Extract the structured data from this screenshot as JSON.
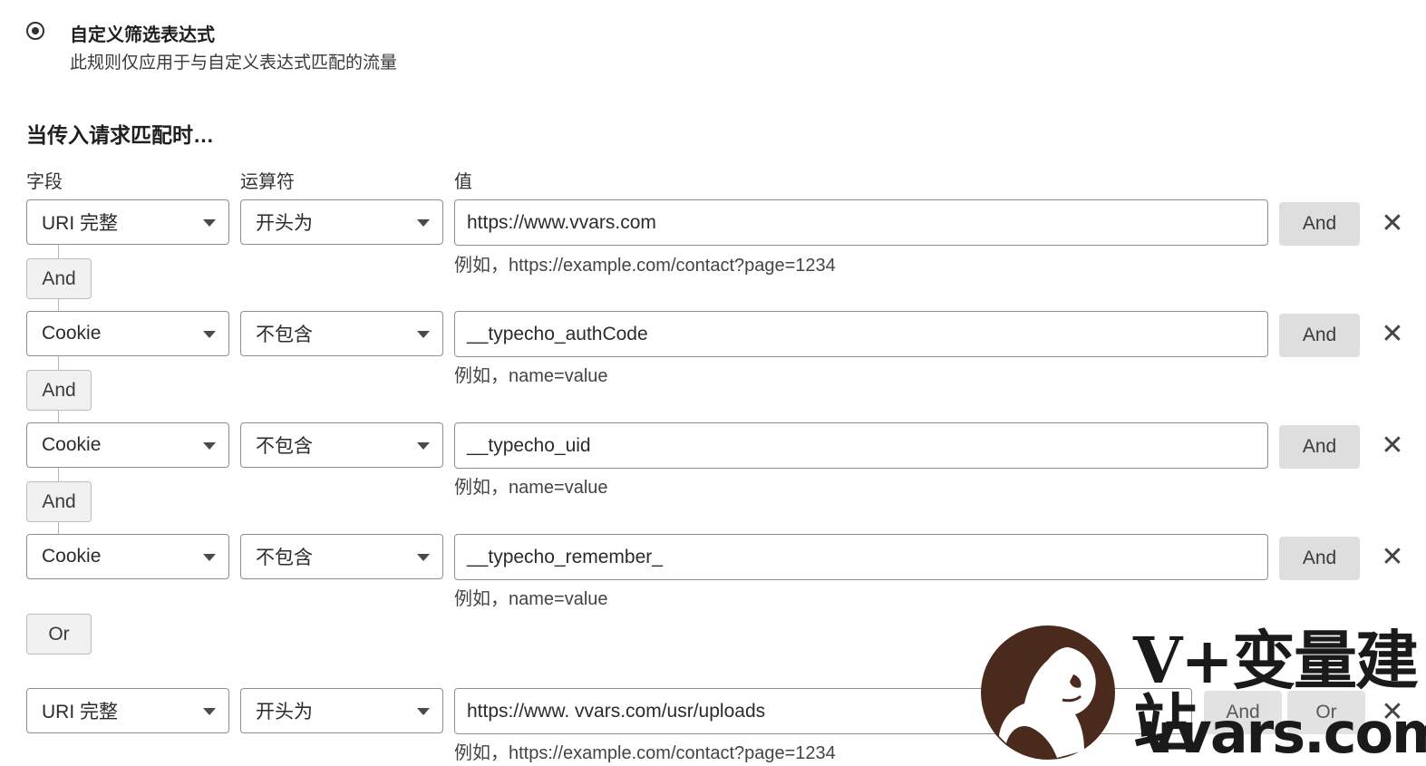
{
  "scope": {
    "option_title": "自定义筛选表达式",
    "option_description": "此规则仅应用于与自定义表达式匹配的流量"
  },
  "section_title": "当传入请求匹配时…",
  "columns": {
    "field": "字段",
    "operator": "运算符",
    "value": "值"
  },
  "rules": [
    {
      "field": "URI 完整",
      "operator": "开头为",
      "value": "https://www.vvars.com",
      "hint": "例如，https://example.com/contact?page=1234",
      "and_button": "And"
    },
    {
      "connector": "And",
      "field": "Cookie",
      "operator": "不包含",
      "value": "__typecho_authCode",
      "hint": "例如，name=value",
      "and_button": "And"
    },
    {
      "connector": "And",
      "field": "Cookie",
      "operator": "不包含",
      "value": "__typecho_uid",
      "hint": "例如，name=value",
      "and_button": "And"
    },
    {
      "connector": "And",
      "field": "Cookie",
      "operator": "不包含",
      "value": "__typecho_remember_",
      "hint": "例如，name=value",
      "and_button": "And"
    }
  ],
  "group_connector": "Or",
  "last_rule": {
    "field": "URI 完整",
    "operator": "开头为",
    "value": "https://www. vvars.com/usr/uploads",
    "hint": "例如，https://example.com/contact?page=1234",
    "and_button": "And",
    "or_button": "Or"
  },
  "watermark": {
    "brand": "V+变量建站",
    "url": "vvars.com"
  },
  "icons": {
    "close": "close-icon",
    "dropdown": "chevron-down-icon",
    "radio": "radio-selected-icon",
    "logo": "gorilla-logo"
  },
  "colors": {
    "button_bg": "#dedede",
    "border": "#8f8f8f",
    "logo_brown": "#4a2a1d"
  }
}
